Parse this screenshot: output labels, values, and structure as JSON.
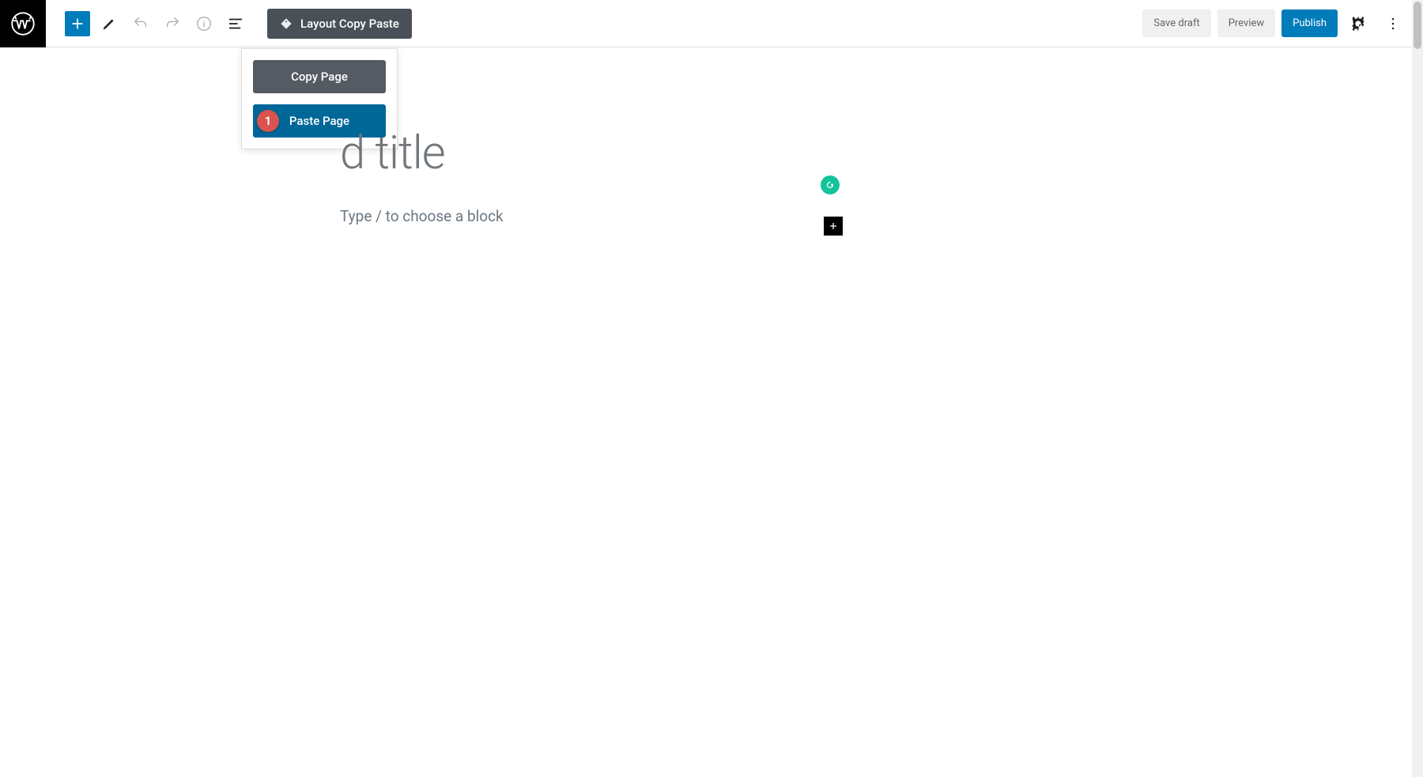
{
  "toolbar": {
    "layout_copy_paste": "Layout Copy Paste",
    "save_draft": "Save draft",
    "preview": "Preview",
    "publish": "Publish"
  },
  "dropdown": {
    "copy_page": "Copy Page",
    "paste_page": "Paste Page"
  },
  "annotation": {
    "number": "1"
  },
  "editor": {
    "title_placeholder": "d title",
    "block_prompt": "Type / to choose a block"
  }
}
